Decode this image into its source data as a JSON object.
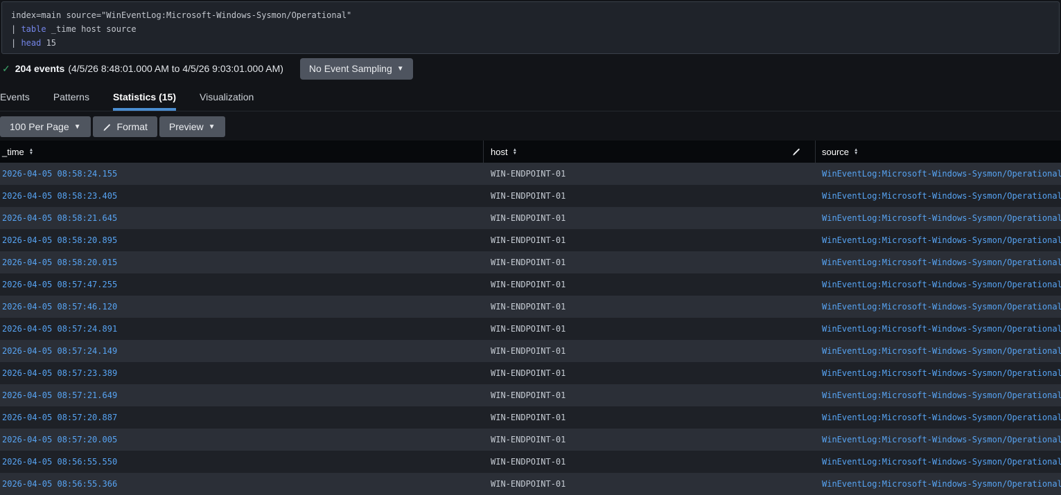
{
  "query": {
    "lines": [
      [
        {
          "t": "index=main source=\"WinEventLog:Microsoft-Windows-Sysmon/Operational\"",
          "c": "plain"
        }
      ],
      [
        {
          "t": "| ",
          "c": "plain"
        },
        {
          "t": "table",
          "c": "keyword"
        },
        {
          "t": " _time host source",
          "c": "plain"
        }
      ],
      [
        {
          "t": "| ",
          "c": "plain"
        },
        {
          "t": "head",
          "c": "keyword"
        },
        {
          "t": " 15",
          "c": "plain"
        }
      ]
    ]
  },
  "events_bar": {
    "check_icon": "✓",
    "count_label": "204 events",
    "range_label": "(4/5/26 8:48:01.000 AM to 4/5/26 9:03:01.000 AM)",
    "sampling_button": "No Event Sampling"
  },
  "tabs": [
    {
      "label": "Events",
      "active": false
    },
    {
      "label": "Patterns",
      "active": false
    },
    {
      "label": "Statistics (15)",
      "active": true
    },
    {
      "label": "Visualization",
      "active": false
    }
  ],
  "toolbar": {
    "per_page_button": "100 Per Page",
    "format_button": "Format",
    "preview_button": "Preview"
  },
  "table": {
    "columns": [
      "_time",
      "host",
      "source"
    ],
    "rows": [
      [
        "2026-04-05 08:58:24.155",
        "WIN-ENDPOINT-01",
        "WinEventLog:Microsoft-Windows-Sysmon/Operational"
      ],
      [
        "2026-04-05 08:58:23.405",
        "WIN-ENDPOINT-01",
        "WinEventLog:Microsoft-Windows-Sysmon/Operational"
      ],
      [
        "2026-04-05 08:58:21.645",
        "WIN-ENDPOINT-01",
        "WinEventLog:Microsoft-Windows-Sysmon/Operational"
      ],
      [
        "2026-04-05 08:58:20.895",
        "WIN-ENDPOINT-01",
        "WinEventLog:Microsoft-Windows-Sysmon/Operational"
      ],
      [
        "2026-04-05 08:58:20.015",
        "WIN-ENDPOINT-01",
        "WinEventLog:Microsoft-Windows-Sysmon/Operational"
      ],
      [
        "2026-04-05 08:57:47.255",
        "WIN-ENDPOINT-01",
        "WinEventLog:Microsoft-Windows-Sysmon/Operational"
      ],
      [
        "2026-04-05 08:57:46.120",
        "WIN-ENDPOINT-01",
        "WinEventLog:Microsoft-Windows-Sysmon/Operational"
      ],
      [
        "2026-04-05 08:57:24.891",
        "WIN-ENDPOINT-01",
        "WinEventLog:Microsoft-Windows-Sysmon/Operational"
      ],
      [
        "2026-04-05 08:57:24.149",
        "WIN-ENDPOINT-01",
        "WinEventLog:Microsoft-Windows-Sysmon/Operational"
      ],
      [
        "2026-04-05 08:57:23.389",
        "WIN-ENDPOINT-01",
        "WinEventLog:Microsoft-Windows-Sysmon/Operational"
      ],
      [
        "2026-04-05 08:57:21.649",
        "WIN-ENDPOINT-01",
        "WinEventLog:Microsoft-Windows-Sysmon/Operational"
      ],
      [
        "2026-04-05 08:57:20.887",
        "WIN-ENDPOINT-01",
        "WinEventLog:Microsoft-Windows-Sysmon/Operational"
      ],
      [
        "2026-04-05 08:57:20.005",
        "WIN-ENDPOINT-01",
        "WinEventLog:Microsoft-Windows-Sysmon/Operational"
      ],
      [
        "2026-04-05 08:56:55.550",
        "WIN-ENDPOINT-01",
        "WinEventLog:Microsoft-Windows-Sysmon/Operational"
      ],
      [
        "2026-04-05 08:56:55.366",
        "WIN-ENDPOINT-01",
        "WinEventLog:Microsoft-Windows-Sysmon/Operational"
      ]
    ]
  },
  "colors": {
    "link_blue": "#57a3f2",
    "keyword_blue": "#7485e8",
    "success_green": "#3fa76c",
    "tab_underline_blue": "#4a8dd0",
    "button_gray": "#4f555f",
    "row_odd": "#2b2f37",
    "row_even": "#1e2127",
    "header_black": "#07090c"
  }
}
